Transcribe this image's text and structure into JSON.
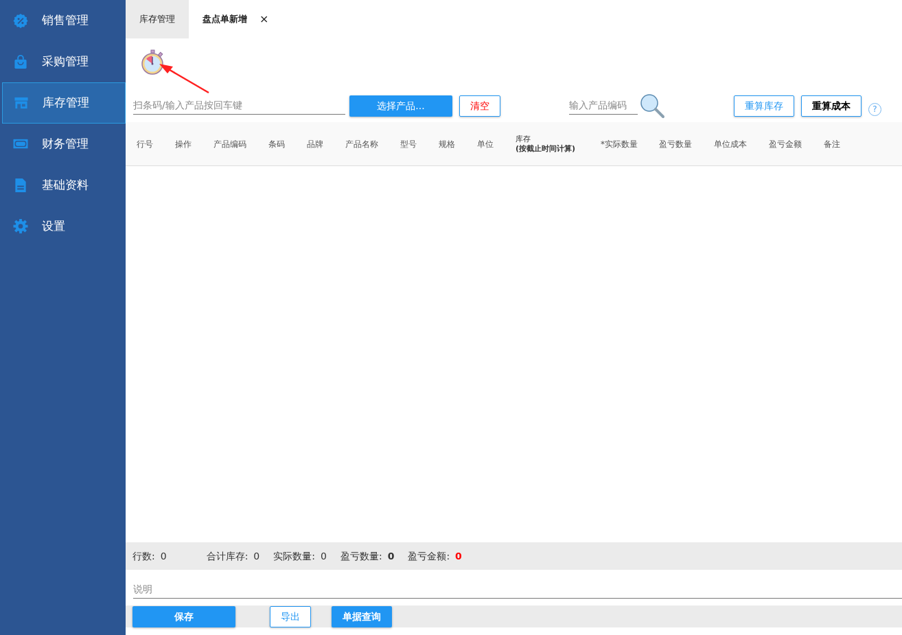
{
  "sidebar": {
    "items": [
      {
        "label": "销售管理",
        "selected": false
      },
      {
        "label": "采购管理",
        "selected": false
      },
      {
        "label": "库存管理",
        "selected": true
      },
      {
        "label": "财务管理",
        "selected": false
      },
      {
        "label": "基础资料",
        "selected": false
      },
      {
        "label": "设置",
        "selected": false
      }
    ]
  },
  "tabs": [
    {
      "label": "库存管理",
      "selected": false
    },
    {
      "label": "盘点单新增",
      "selected": true,
      "close": "×"
    }
  ],
  "toolbar": {
    "scan_field": {
      "placeholder": "扫条码/输入产品按回车键"
    },
    "select_button": "选择产品...",
    "clear_button": "清空",
    "code_field": {
      "placeholder": "输入产品编码"
    },
    "recalc_stock_button": "重算库存",
    "recalc_cost_button": "重算成本",
    "help": "?"
  },
  "table": {
    "columns": [
      {
        "label": "行号"
      },
      {
        "label": "操作"
      },
      {
        "label": "产品编码"
      },
      {
        "label": "条码"
      },
      {
        "label": "品牌"
      },
      {
        "label": "产品名称"
      },
      {
        "label": "型号"
      },
      {
        "label": "规格"
      },
      {
        "label": "单位"
      },
      {
        "label": "库存",
        "sublabel": "(按截止时间计算)"
      },
      {
        "label": "*实际数量"
      },
      {
        "label": "盈亏数量"
      },
      {
        "label": "单位成本"
      },
      {
        "label": "盈亏金额"
      },
      {
        "label": "备注"
      }
    ]
  },
  "summary": [
    {
      "label": "行数:",
      "value": "0",
      "kind": "plain"
    },
    {
      "label": "合计库存:",
      "value": "0",
      "kind": "plain"
    },
    {
      "label": "实际数量:",
      "value": "0",
      "kind": "plain"
    },
    {
      "label": "盈亏数量:",
      "value": "0",
      "kind": "bold"
    },
    {
      "label": "盈亏金额:",
      "value": "0",
      "kind": "alert"
    }
  ],
  "note_field": {
    "placeholder": "说明"
  },
  "actions": [
    {
      "label": "保存",
      "kind": "primary"
    },
    {
      "label": "导出",
      "kind": "outline"
    },
    {
      "label": "单据查询",
      "kind": "primary"
    }
  ]
}
